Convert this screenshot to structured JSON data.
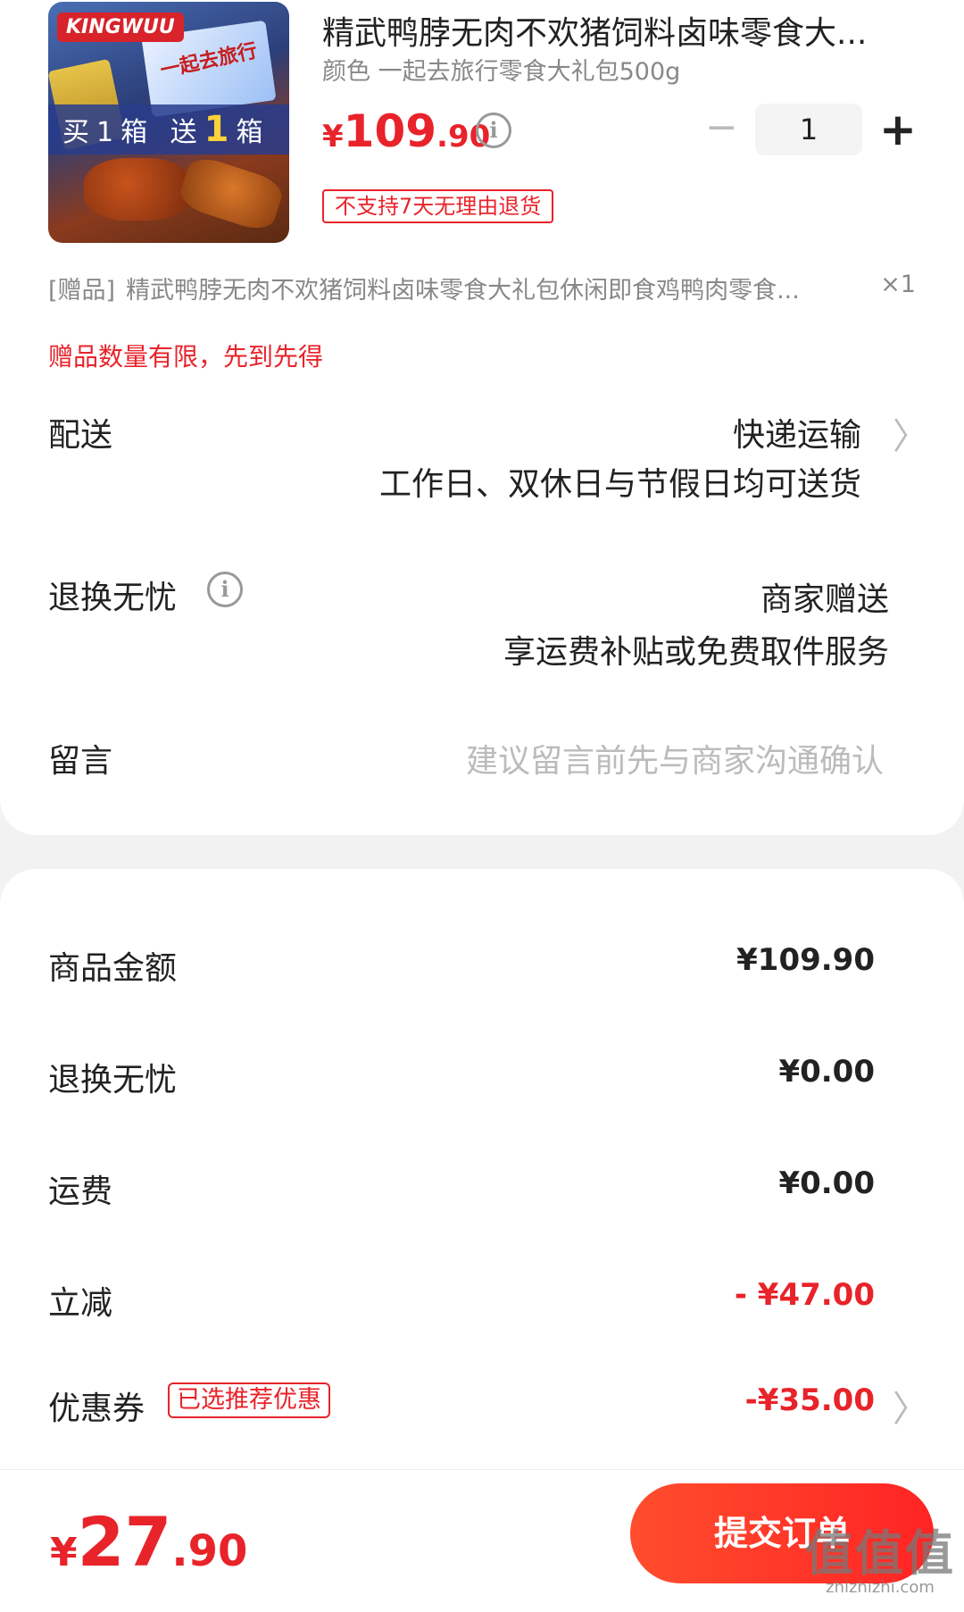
{
  "product": {
    "title": "精武鸭脖无肉不欢猪饲料卤味零食大...",
    "spec": "颜色 一起去旅行零食大礼包500g",
    "image": {
      "brand_logo": "KINGWUU",
      "box_text": "一起去旅行",
      "promo": {
        "part1": "买",
        "num1": "1",
        "part2": "箱 送",
        "num2": "1",
        "part3": "箱"
      }
    },
    "price": {
      "currency": "¥",
      "integer": "109",
      "decimal": ".90"
    },
    "quantity": "1",
    "return_policy": "不支持7天无理由退货"
  },
  "gift": {
    "tag": "[赠品]",
    "name": "精武鸭脖无肉不欢猪饲料卤味零食大礼包休闲即食鸡鸭肉零食...",
    "qty": "×1",
    "note": "赠品数量有限，先到先得"
  },
  "delivery": {
    "label": "配送",
    "method": "快递运输",
    "detail": "工作日、双休日与节假日均可送货"
  },
  "worry_free": {
    "label": "退换无忧",
    "value": "商家赠送",
    "detail": "享运费补贴或免费取件服务"
  },
  "message": {
    "label": "留言",
    "placeholder": "建议留言前先与商家沟通确认"
  },
  "summary": {
    "items": [
      {
        "label": "商品金额",
        "value": "¥109.90"
      },
      {
        "label": "退换无忧",
        "value": "¥0.00"
      },
      {
        "label": "运费",
        "value": "¥0.00"
      },
      {
        "label": "立减",
        "value": "- ¥47.00"
      },
      {
        "label": "优惠券",
        "value": "-¥35.00"
      }
    ],
    "coupon_tag": "已选推荐优惠"
  },
  "footer": {
    "total": {
      "currency": "¥",
      "integer": "27",
      "decimal": ".90"
    },
    "submit_label": "提交订单"
  },
  "watermark": {
    "big": "值值值",
    "small": "zhizhizhi.com"
  },
  "colors": {
    "accent": "#e8232a",
    "button": "#ff3a28"
  },
  "icons": {
    "info": "info-icon",
    "chevron": "chevron-right-icon"
  }
}
